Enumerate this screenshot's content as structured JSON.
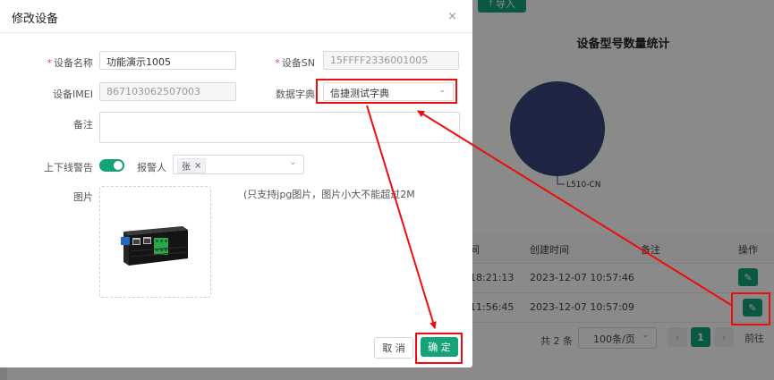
{
  "background": {
    "import_label": "导入",
    "chart_title": "设备型号数量统计",
    "chart_data": {
      "type": "pie",
      "categories": [
        "L510-CN"
      ],
      "values": [
        2
      ],
      "legend": "none"
    },
    "table": {
      "headers": [
        "间",
        "创建时间",
        "备注",
        "操作"
      ],
      "rows": [
        {
          "time_fragment": "18:21:13",
          "created": "2023-12-07 10:57:46",
          "note": ""
        },
        {
          "time_fragment": "11:56:45",
          "created": "2023-12-07 10:57:09",
          "note": ""
        }
      ]
    },
    "pagination": {
      "total": "共 2 条",
      "page_size": "100条/页",
      "current": "1",
      "goto": "前往"
    }
  },
  "dialog": {
    "title": "修改设备",
    "close": "×",
    "fields": {
      "name_label": "设备名称",
      "name_value": "功能演示1005",
      "sn_label": "设备SN",
      "sn_value": "15FFFF2336001005",
      "imei_label": "设备IMEI",
      "imei_value": "867103062507003",
      "dict_label": "数据字典",
      "dict_value": "信捷测试字典",
      "remark_label": "备注",
      "remark_value": "",
      "alarm_label": "上下线警告",
      "alarm_enabled": true,
      "reporter_label": "报警人",
      "reporter_tag": "张",
      "image_label": "图片",
      "image_hint": "(只支持jpg图片，图片小大不能超过2M"
    },
    "footer": {
      "cancel": "取 消",
      "confirm": "确 定"
    }
  },
  "colors": {
    "primary": "#16a37a",
    "pie": "#39457a",
    "annotation": "#ee0d0d"
  }
}
